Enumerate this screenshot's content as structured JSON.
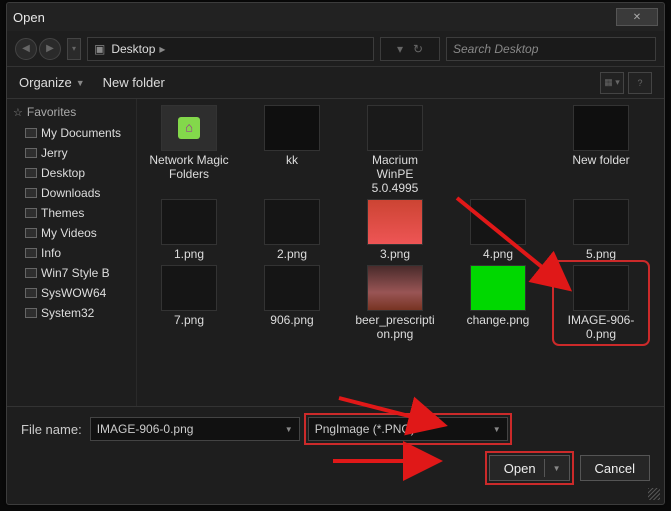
{
  "window": {
    "title": "Open",
    "close_glyph": "✕"
  },
  "nav": {
    "location": "Desktop",
    "search_placeholder": "Search Desktop"
  },
  "toolbar": {
    "organize_label": "Organize",
    "newfolder_label": "New folder"
  },
  "sidebar": {
    "header": "Favorites",
    "items": [
      "My Documents",
      "Jerry",
      "Desktop",
      "Downloads",
      "Themes",
      "My Videos",
      "Info",
      "Win7 Style B",
      "SysWOW64",
      "System32"
    ]
  },
  "files": [
    {
      "label": "Network Magic Folders",
      "kind": "netmagic"
    },
    {
      "label": "kk",
      "kind": "folder"
    },
    {
      "label": "Macrium WinPE 5.0.4995",
      "kind": "macicon"
    },
    {
      "label": "New folder",
      "kind": "folder"
    },
    {
      "label": "1.png",
      "kind": "dark"
    },
    {
      "label": "2.png",
      "kind": "dark"
    },
    {
      "label": "3.png",
      "kind": "pinky"
    },
    {
      "label": "4.png",
      "kind": "dark"
    },
    {
      "label": "5.png",
      "kind": "dark"
    },
    {
      "label": "7.png",
      "kind": "dark"
    },
    {
      "label": "906.png",
      "kind": "dark"
    },
    {
      "label": "beer_prescription.png",
      "kind": "pinkcan"
    },
    {
      "label": "change.png",
      "kind": "green"
    },
    {
      "label": "IMAGE-906-0.png",
      "kind": "dark",
      "selected": true
    }
  ],
  "footer": {
    "filename_label": "File name:",
    "filename_value": "IMAGE-906-0.png",
    "filetype_value": "PngImage (*.PNG)",
    "open_label": "Open",
    "cancel_label": "Cancel"
  }
}
